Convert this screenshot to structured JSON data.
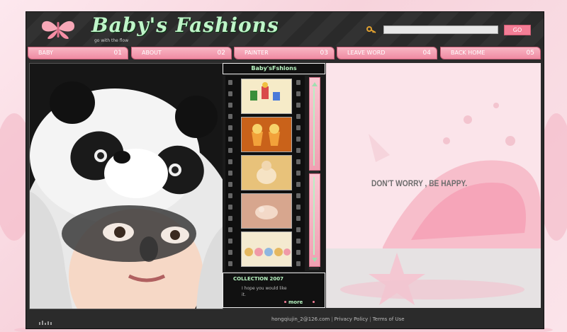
{
  "header": {
    "title": "Baby's Fashions",
    "tagline": "go with the flow",
    "search": {
      "value": "",
      "go_label": "GO"
    }
  },
  "nav": [
    {
      "label": "BABY",
      "number": "01"
    },
    {
      "label": "ABOUT",
      "number": "02"
    },
    {
      "label": "PAINTER",
      "number": "03"
    },
    {
      "label": "LEAVE WORD",
      "number": "04"
    },
    {
      "label": "BACK HOME",
      "number": "05"
    }
  ],
  "gallery": {
    "title": "Baby'sFshions"
  },
  "collection": {
    "title": "COLLECTION 2007",
    "text": "I hope you would like it.",
    "more_label": "more"
  },
  "hero": {
    "slogan": "DON'T WORRY , BE HAPPY."
  },
  "footer": {
    "email": "hongqiujin_2@126.com",
    "privacy": "Privacy Policy",
    "terms": "Terms of Use"
  },
  "colors": {
    "accent_pink": "#f37e96",
    "mint_text": "#bff5c9",
    "frame": "#2b2b2b"
  },
  "icons": [
    "butterfly-logo-icon",
    "key-icon",
    "scroll-up-arrow-icon",
    "scroll-down-arrow-icon",
    "equalizer-icon"
  ]
}
